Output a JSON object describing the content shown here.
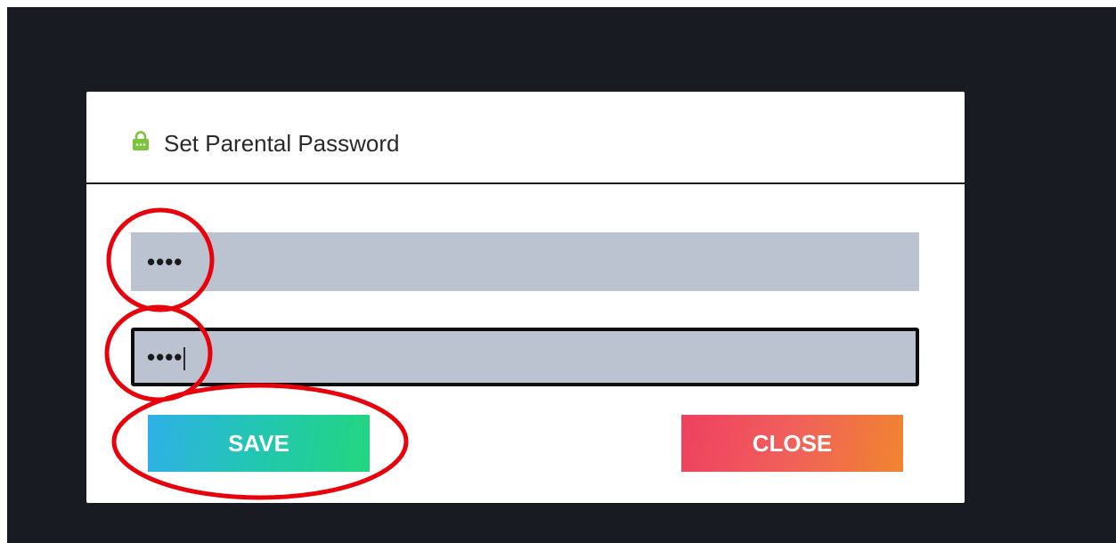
{
  "dialog": {
    "title": "Set Parental Password",
    "icon": "lock-icon",
    "password_field": {
      "value": "••••"
    },
    "confirm_password_field": {
      "value": "••••"
    },
    "save_label": "SAVE",
    "close_label": "CLOSE"
  },
  "colors": {
    "screen_background": "#181b22",
    "dialog_background": "#ffffff",
    "field_background": "#bcc3d0",
    "lock_icon": "#7cc53a",
    "save_gradient": [
      "#2eb0e8",
      "#22d67f"
    ],
    "close_gradient": [
      "#ef4060",
      "#f0852f"
    ],
    "annotation_circle": "#e8000b"
  }
}
